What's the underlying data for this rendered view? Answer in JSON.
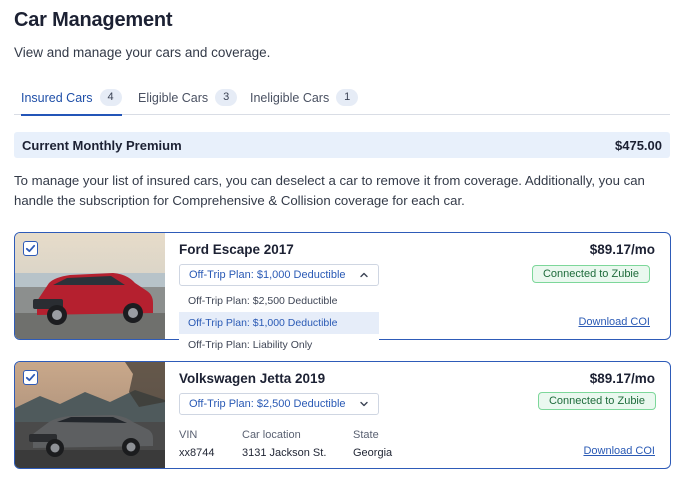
{
  "page": {
    "title": "Car Management",
    "subtitle": "View and manage your cars and coverage."
  },
  "tabs": [
    {
      "label": "Insured Cars",
      "count": "4",
      "active": true
    },
    {
      "label": "Eligible Cars",
      "count": "3",
      "active": false
    },
    {
      "label": "Ineligible Cars",
      "count": "1",
      "active": false
    }
  ],
  "premium": {
    "label": "Current Monthly Premium",
    "amount": "$475.00"
  },
  "info_text": "To manage your list of insured cars, you can deselect a car to remove it from coverage. Additionally, you can handle the subscription for Comprehensive & Collision coverage for each car.",
  "cars": [
    {
      "name": "Ford Escape 2017",
      "price": "$89.17/mo",
      "plan": "Off-Trip Plan: $1,000 Deductible",
      "badge": "Connected to Zubie",
      "download": "Download COI",
      "checked": true,
      "dropdown_open": true,
      "options": [
        "Off-Trip Plan: $2,500 Deductible",
        "Off-Trip Plan: $1,000 Deductible",
        "Off-Trip Plan: Liability Only"
      ],
      "body_color": "#b5202f"
    },
    {
      "name": "Volkswagen Jetta 2019",
      "price": "$89.17/mo",
      "plan": "Off-Trip Plan: $2,500 Deductible",
      "badge": "Connected to Zubie",
      "download": "Download COI",
      "checked": true,
      "dropdown_open": false,
      "details": {
        "vin_label": "VIN",
        "vin": "xx8744",
        "location_label": "Car location",
        "location": "3131 Jackson St.",
        "state_label": "State",
        "state": "Georgia"
      },
      "body_color": "#5d5f61"
    }
  ],
  "colors": {
    "accent": "#2e5bb8",
    "badge_green": "#7dd79a",
    "premium_bg": "#e8f0fb"
  }
}
